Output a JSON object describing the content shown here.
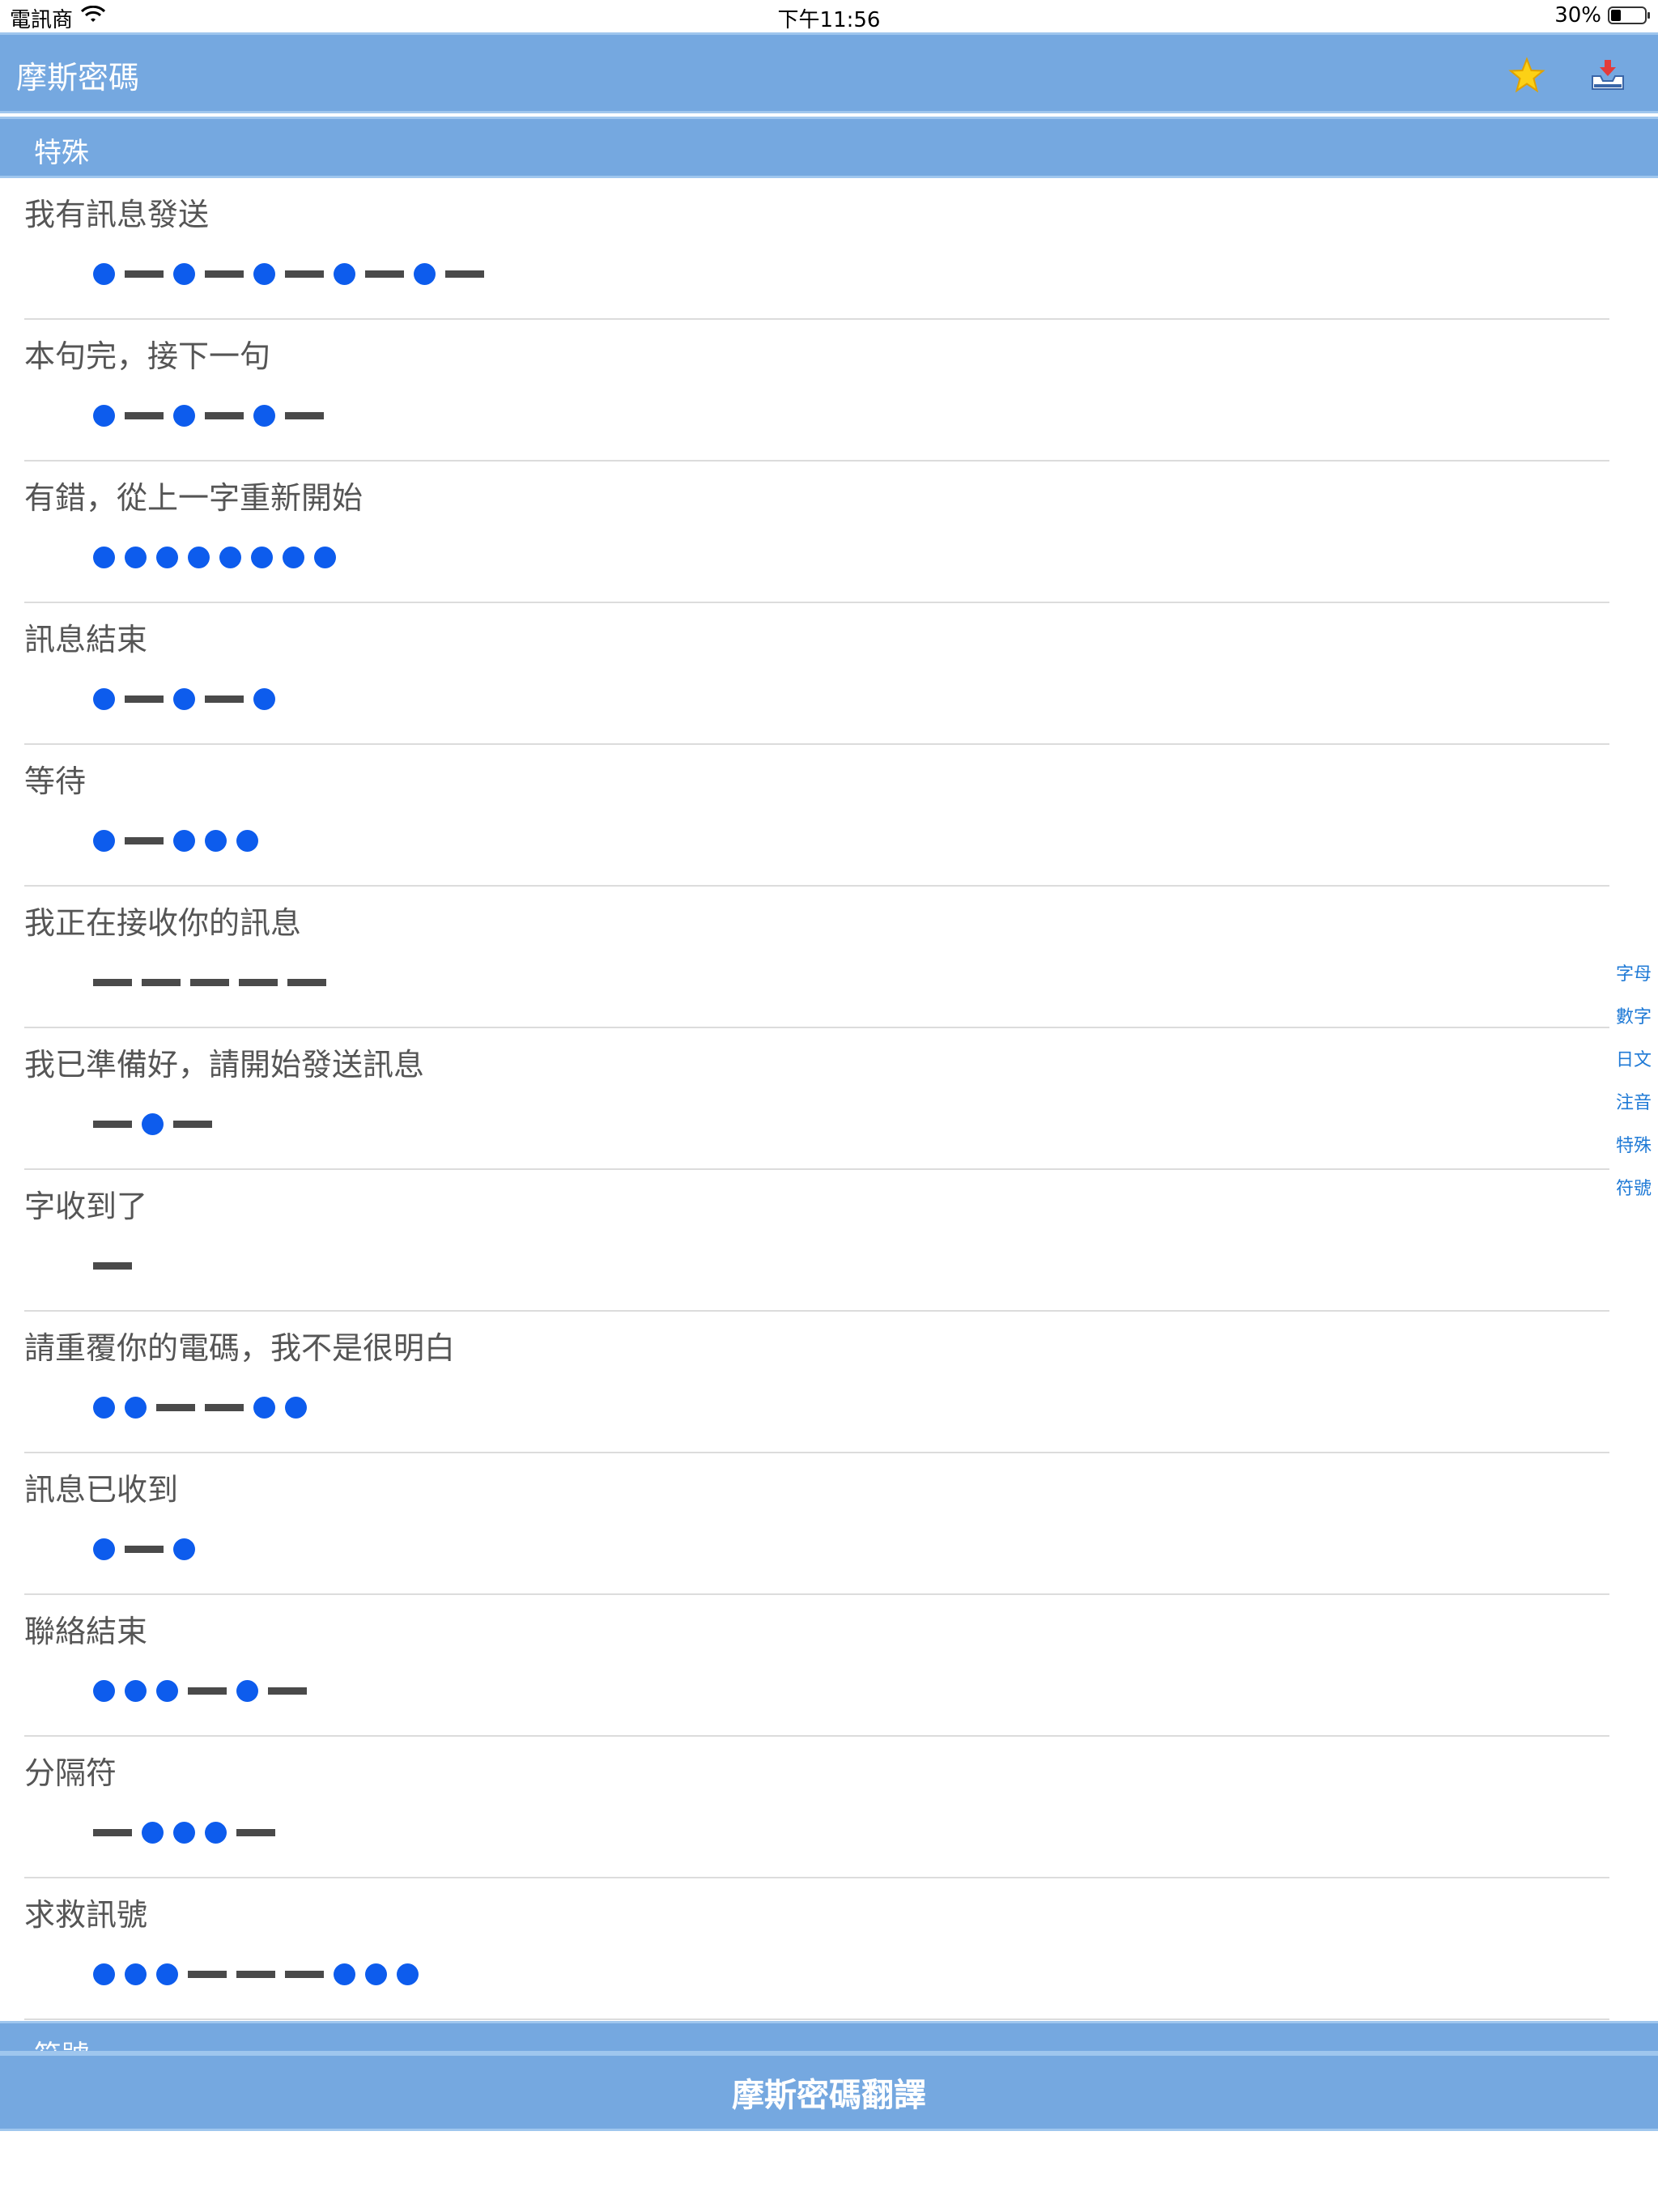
{
  "status_bar": {
    "carrier": "電訊商",
    "time": "下午11:56",
    "battery": "30%"
  },
  "nav": {
    "title": "摩斯密碼",
    "icons": [
      "star-icon",
      "inbox-download-icon"
    ]
  },
  "section": {
    "title": "特殊",
    "next_title": "符號"
  },
  "items": [
    {
      "label": "我有訊息發送",
      "code": ".-.-.-.-.-"
    },
    {
      "label": "本句完，接下一句",
      "code": ".-.-.-"
    },
    {
      "label": "有錯，從上一字重新開始",
      "code": "........"
    },
    {
      "label": "訊息結束",
      "code": ".-.-."
    },
    {
      "label": "等待",
      "code": ".-..."
    },
    {
      "label": "我正在接收你的訊息",
      "code": "-----"
    },
    {
      "label": "我已準備好，請開始發送訊息",
      "code": "-.-"
    },
    {
      "label": "字收到了",
      "code": "-"
    },
    {
      "label": "請重覆你的電碼，我不是很明白",
      "code": "..--.."
    },
    {
      "label": "訊息已收到",
      "code": ".-."
    },
    {
      "label": "聯絡結束",
      "code": "...-.-"
    },
    {
      "label": "分隔符",
      "code": "-...-"
    },
    {
      "label": "求救訊號",
      "code": "...---..."
    }
  ],
  "index": [
    "字母",
    "數字",
    "日文",
    "注音",
    "特殊",
    "符號"
  ],
  "bottom": {
    "button_label": "摩斯密碼翻譯"
  },
  "colors": {
    "header": "#75a8e0",
    "dot": "#0d5ced",
    "dash": "#4a4a4a",
    "index_text": "#1f7ad6"
  }
}
